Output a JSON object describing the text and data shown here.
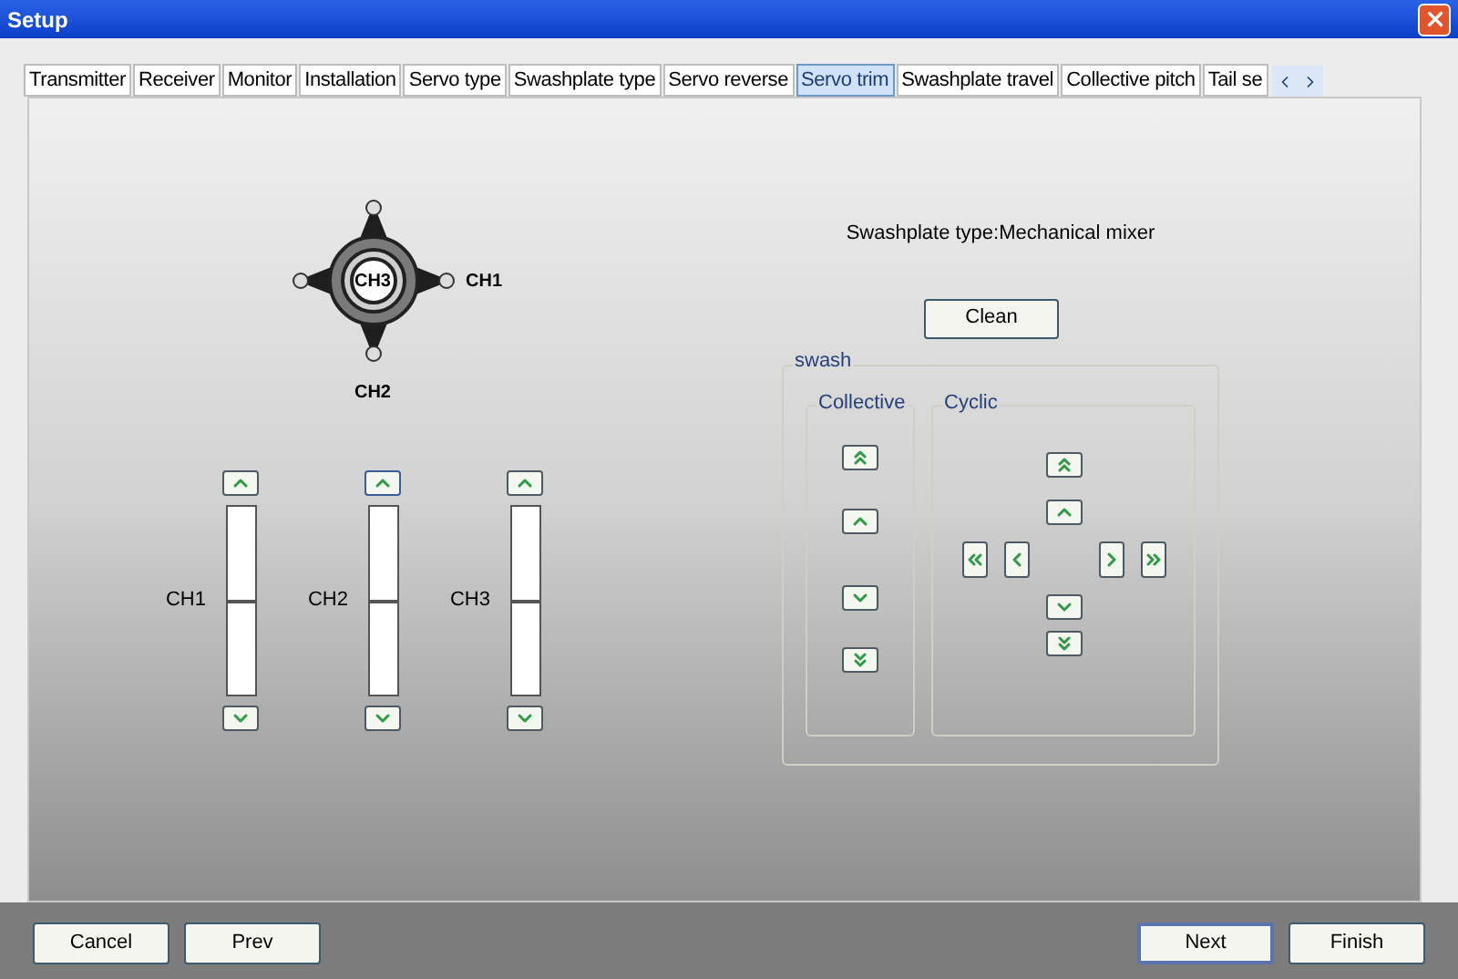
{
  "window": {
    "title": "Setup"
  },
  "tabs": [
    {
      "label": "Transmitter",
      "selected": false
    },
    {
      "label": "Receiver",
      "selected": false
    },
    {
      "label": "Monitor",
      "selected": false
    },
    {
      "label": "Installation",
      "selected": false
    },
    {
      "label": "Servo type",
      "selected": false
    },
    {
      "label": "Swashplate type",
      "selected": false
    },
    {
      "label": "Servo reverse",
      "selected": false
    },
    {
      "label": "Servo trim",
      "selected": true
    },
    {
      "label": "Swashplate travel",
      "selected": false
    },
    {
      "label": "Collective pitch",
      "selected": false
    },
    {
      "label": "Tail se",
      "selected": false
    }
  ],
  "swashplate": {
    "center_label": "CH3",
    "side_label": "CH1",
    "bottom_label": "CH2"
  },
  "channels": [
    {
      "label": "CH1",
      "level": 0.5,
      "up_focused": false
    },
    {
      "label": "CH2",
      "level": 0.5,
      "up_focused": true
    },
    {
      "label": "CH3",
      "level": 0.5,
      "up_focused": false
    }
  ],
  "swashplate_type": "Swashplate type:Mechanical mixer",
  "clean_button": "Clean",
  "swash": {
    "title": "swash",
    "collective": {
      "title": "Collective"
    },
    "cyclic": {
      "title": "Cyclic"
    }
  },
  "footer_left": [
    {
      "label": "Cancel",
      "default": false
    },
    {
      "label": "Prev",
      "default": false
    }
  ],
  "footer_right": [
    {
      "label": "Next",
      "default": true
    },
    {
      "label": "Finish",
      "default": false
    }
  ]
}
